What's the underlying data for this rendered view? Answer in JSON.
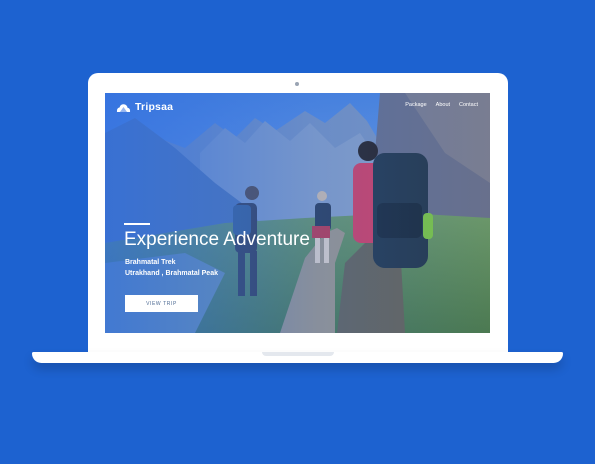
{
  "brand": {
    "name": "Tripsaa",
    "icon": "mountain-cloud-icon"
  },
  "nav": [
    "Package",
    "About",
    "Contact"
  ],
  "hero": {
    "title": "Experience Adventure",
    "subtitle_line1": "Brahmatal Trek",
    "subtitle_line2": "Utrakhand , Brahmatal Peak",
    "cta_label": "VIEW TRIP"
  },
  "colors": {
    "background": "#1d62d0",
    "overlay": "#2f6ee0",
    "device": "#ffffff"
  }
}
